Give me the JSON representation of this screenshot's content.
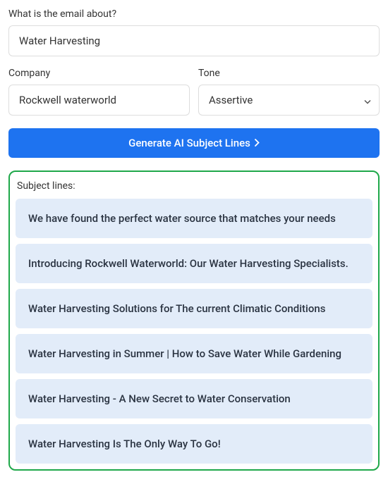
{
  "form": {
    "email_about": {
      "label": "What is the email about?",
      "value": "Water Harvesting"
    },
    "company": {
      "label": "Company",
      "value": "Rockwell waterworld"
    },
    "tone": {
      "label": "Tone",
      "value": "Assertive"
    },
    "generate_button": "Generate AI Subject Lines"
  },
  "results": {
    "title": "Subject lines:",
    "items": [
      "We have found the perfect water source that matches your needs",
      "Introducing Rockwell Waterworld: Our Water Harvesting Specialists.",
      "Water Harvesting Solutions for The current Climatic Conditions",
      "Water Harvesting in Summer | How to Save Water While Gardening",
      "Water Harvesting - A New Secret to Water Conservation",
      "Water Harvesting Is The Only Way To Go!"
    ]
  }
}
